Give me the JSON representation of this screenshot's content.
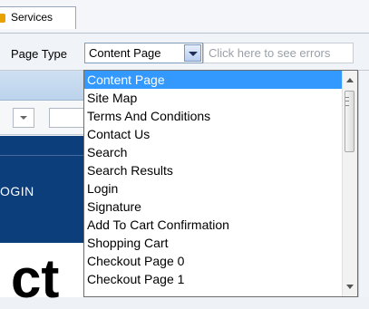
{
  "tabs": [
    {
      "label": "Services",
      "active": true
    }
  ],
  "toolbar": {
    "page_type_label": "Page Type",
    "selected_value": "Content Page",
    "errors_link": "Click here to see errors"
  },
  "background": {
    "login_text": "OGIN",
    "big_text": "ct"
  },
  "dropdown": {
    "selected_index": 0,
    "items": [
      {
        "label": "Content Page"
      },
      {
        "label": "Site Map"
      },
      {
        "label": "Terms And Conditions"
      },
      {
        "label": "Contact Us"
      },
      {
        "label": "Search"
      },
      {
        "label": "Search Results"
      },
      {
        "label": "Login"
      },
      {
        "label": "Signature"
      },
      {
        "label": "Add To Cart Confirmation"
      },
      {
        "label": "Shopping Cart"
      },
      {
        "label": "Checkout Page 0"
      },
      {
        "label": "Checkout Page 1"
      }
    ]
  },
  "colors": {
    "selection": "#3399ff",
    "dark_panel": "#0d3e7c"
  }
}
